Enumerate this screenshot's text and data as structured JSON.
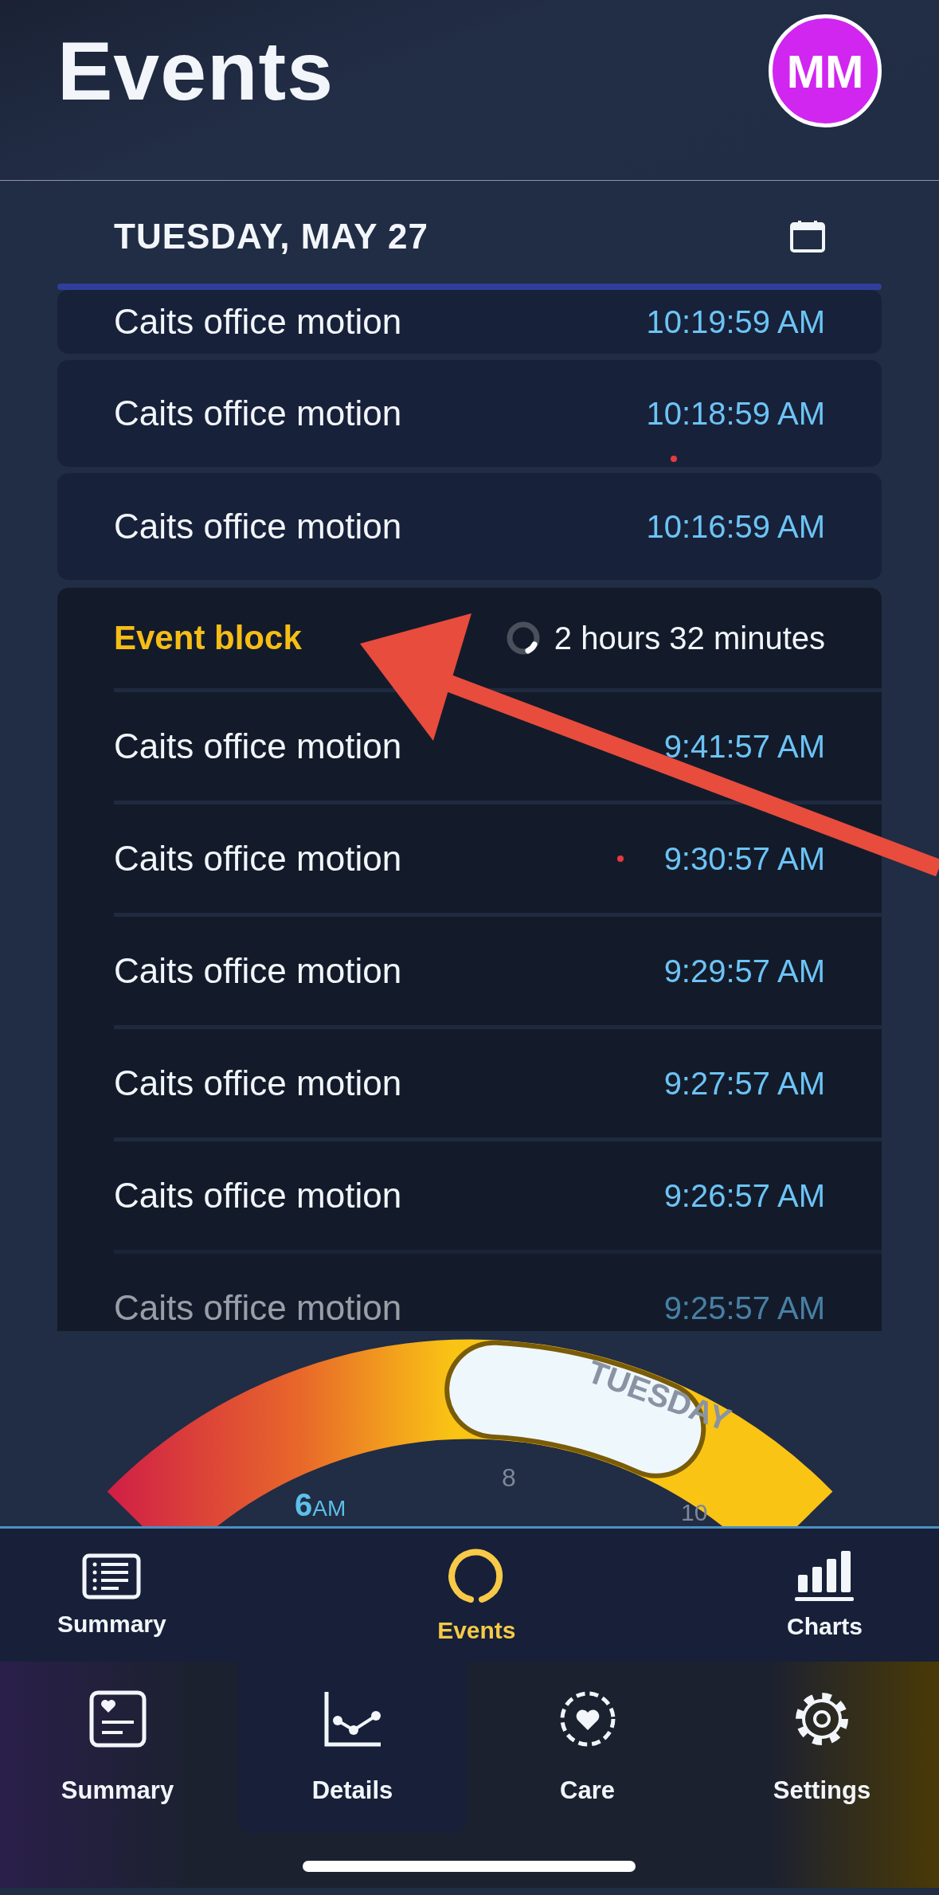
{
  "header": {
    "title": "Events",
    "avatar": "MM"
  },
  "date": "TUESDAY, MAY 27",
  "events": [
    {
      "label": "Caits office motion",
      "time": "10:19:59 AM",
      "dot": false
    },
    {
      "label": "Caits office motion",
      "time": "10:18:59 AM",
      "dot": true
    },
    {
      "label": "Caits office motion",
      "time": "10:16:59 AM",
      "dot": false
    }
  ],
  "event_block": {
    "title": "Event block",
    "duration": "2 hours 32 minutes",
    "rows": [
      {
        "label": "Caits office motion",
        "time": "9:41:57 AM",
        "dot": false,
        "faded": false
      },
      {
        "label": "Caits office motion",
        "time": "9:30:57 AM",
        "dot": true,
        "faded": false
      },
      {
        "label": "Caits office motion",
        "time": "9:29:57 AM",
        "dot": false,
        "faded": false
      },
      {
        "label": "Caits office motion",
        "time": "9:27:57 AM",
        "dot": false,
        "faded": false
      },
      {
        "label": "Caits office motion",
        "time": "9:26:57 AM",
        "dot": false,
        "faded": false
      },
      {
        "label": "Caits office motion",
        "time": "9:25:57 AM",
        "dot": false,
        "faded": true
      }
    ]
  },
  "dial": {
    "day": "TUESDAY",
    "current_hour": {
      "value": "6",
      "suffix": "AM"
    },
    "hours": [
      "8",
      "10"
    ]
  },
  "tabs": [
    {
      "label": "Summary",
      "kind": "list",
      "selected": false
    },
    {
      "label": "Events",
      "kind": "ring",
      "selected": true
    },
    {
      "label": "Charts",
      "kind": "bars",
      "selected": false
    }
  ],
  "nav": [
    {
      "label": "Summary",
      "kind": "card",
      "selected": false
    },
    {
      "label": "Details",
      "kind": "line",
      "selected": true
    },
    {
      "label": "Care",
      "kind": "care",
      "selected": false
    },
    {
      "label": "Settings",
      "kind": "gear",
      "selected": false
    }
  ]
}
